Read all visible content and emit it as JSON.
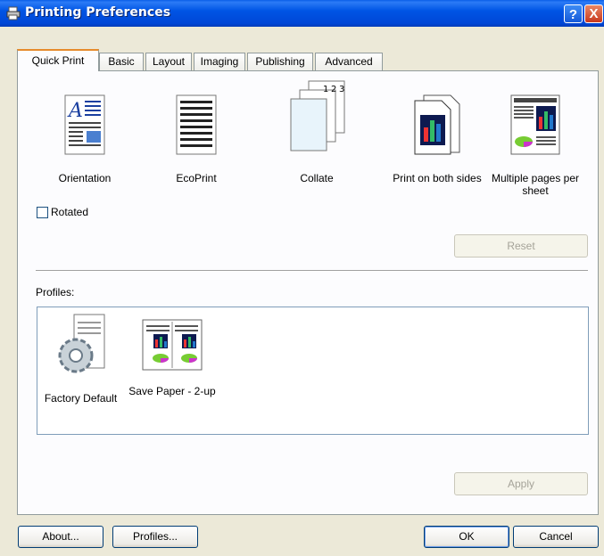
{
  "window": {
    "title": "Printing Preferences",
    "help_label": "?",
    "close_label": "X"
  },
  "tabs": [
    {
      "label": "Quick Print",
      "active": true
    },
    {
      "label": "Basic"
    },
    {
      "label": "Layout"
    },
    {
      "label": "Imaging"
    },
    {
      "label": "Publishing"
    },
    {
      "label": "Advanced"
    }
  ],
  "quick_print": {
    "items": [
      {
        "label": "Orientation",
        "icon": "orientation-icon"
      },
      {
        "label": "EcoPrint",
        "icon": "ecoprint-icon"
      },
      {
        "label": "Collate",
        "icon": "collate-icon"
      },
      {
        "label": "Print on both sides",
        "icon": "duplex-icon"
      },
      {
        "label": "Multiple pages per sheet",
        "icon": "multiple-pages-icon"
      }
    ],
    "collate_numbers": [
      "1",
      "2",
      "3"
    ],
    "rotated_label": "Rotated",
    "reset_label": "Reset"
  },
  "profiles": {
    "label": "Profiles:",
    "items": [
      {
        "label": "Factory Default",
        "icon": "factory-default-icon"
      },
      {
        "label": "Save Paper - 2-up",
        "icon": "save-paper-icon"
      }
    ],
    "apply_label": "Apply"
  },
  "footer": {
    "about_label": "About...",
    "profiles_label": "Profiles...",
    "ok_label": "OK",
    "cancel_label": "Cancel"
  }
}
